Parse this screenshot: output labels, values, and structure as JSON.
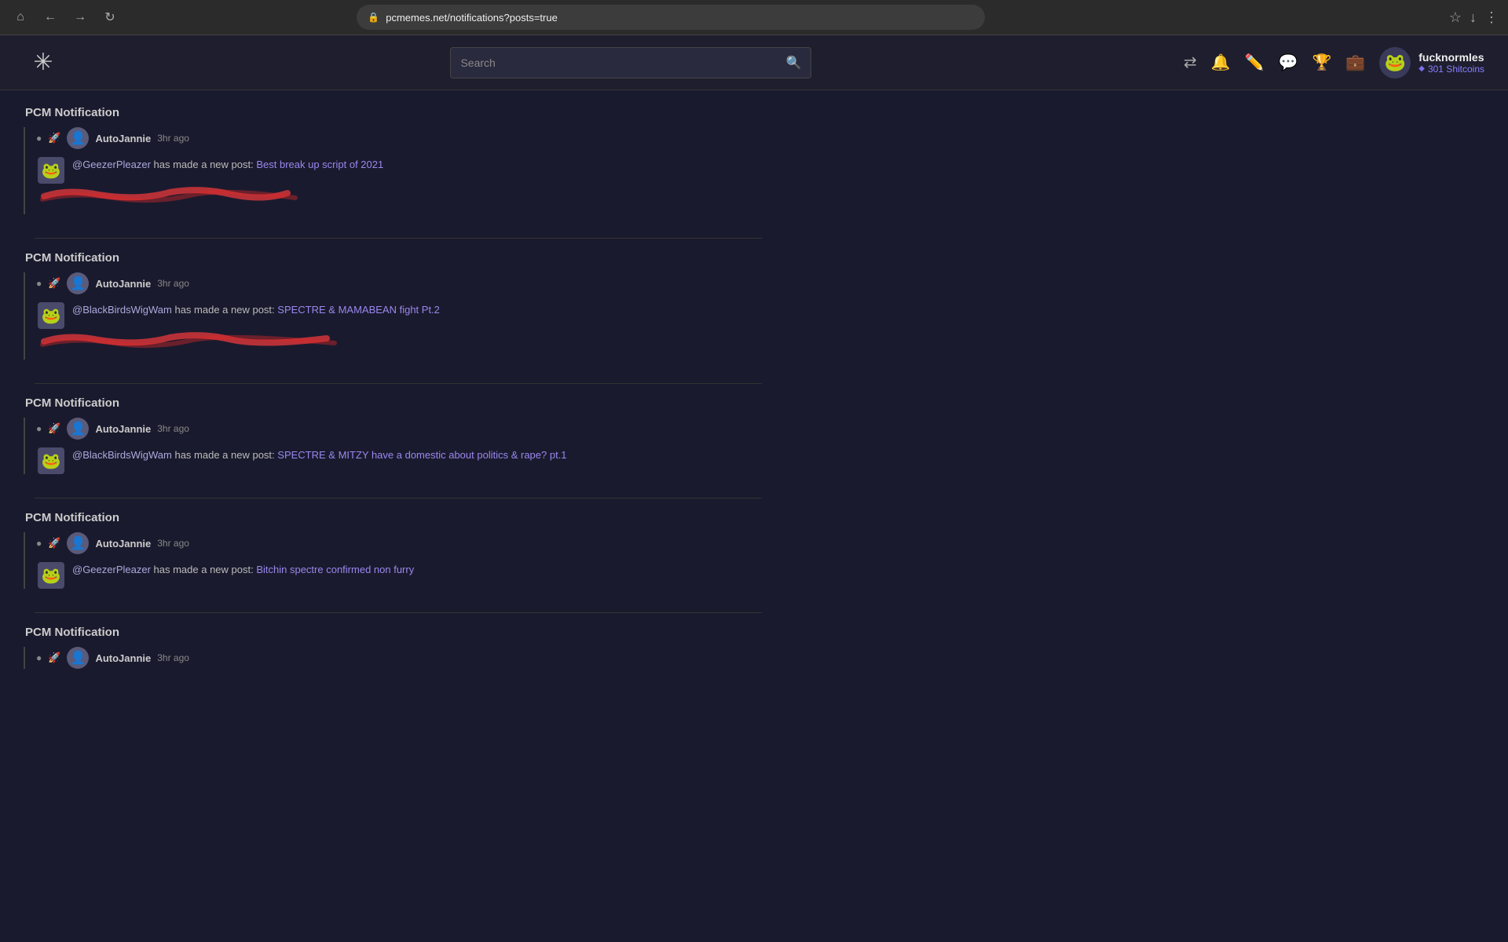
{
  "browser": {
    "url": "pcmemes.net/notifications?posts=true",
    "back_label": "←",
    "forward_label": "→",
    "refresh_label": "↻",
    "home_label": "⌂",
    "bookmark_label": "☆",
    "download_label": "↓",
    "menu_label": "⋮"
  },
  "header": {
    "logo": "✳",
    "search_placeholder": "Search",
    "icons": {
      "shuffle": "⇄",
      "bell": "🔔",
      "feather": "✏",
      "chat": "💬",
      "trophy": "🏆",
      "wallet": "💼"
    },
    "user": {
      "name": "fucknormles",
      "coins": "301 Shitcoins",
      "avatar": "🐸"
    }
  },
  "notifications": [
    {
      "id": "notif-1",
      "header": "PCM Notification",
      "meta": {
        "icon": "●",
        "rocket": "🚀",
        "username": "AutoJannie",
        "time": "3hr ago"
      },
      "poster": "🐸",
      "mention": "@GeezerPleazer",
      "action": "has made a new post:",
      "post_title": "Best break up script of 2021",
      "has_scribble": true,
      "scribble_width": 340,
      "scribble_height": 35
    },
    {
      "id": "notif-2",
      "header": "PCM Notification",
      "meta": {
        "icon": "●",
        "rocket": "🚀",
        "username": "AutoJannie",
        "time": "3hr ago"
      },
      "poster": "🐸",
      "mention": "@BlackBirdsWigWam",
      "action": "has made a new post:",
      "post_title": "SPECTRE & MAMABEAN fight Pt.2",
      "has_scribble": true,
      "scribble_width": 390,
      "scribble_height": 35
    },
    {
      "id": "notif-3",
      "header": "PCM Notification",
      "meta": {
        "icon": "●",
        "rocket": "🚀",
        "username": "AutoJannie",
        "time": "3hr ago"
      },
      "poster": "🐸",
      "mention": "@BlackBirdsWigWam",
      "action": "has made a new post:",
      "post_title": "SPECTRE & MITZY have a domestic about politics & rape? pt.1",
      "has_scribble": false
    },
    {
      "id": "notif-4",
      "header": "PCM Notification",
      "meta": {
        "icon": "●",
        "rocket": "🚀",
        "username": "AutoJannie",
        "time": "3hr ago"
      },
      "poster": "🐸",
      "mention": "@GeezerPleazer",
      "action": "has made a new post:",
      "post_title": "Bitchin spectre confirmed non furry",
      "has_scribble": false
    },
    {
      "id": "notif-5",
      "header": "PCM Notification",
      "meta": {
        "icon": "●",
        "rocket": "🚀",
        "username": "AutoJannie",
        "time": "3hr ago"
      },
      "poster": "🐸",
      "mention": "",
      "action": "",
      "post_title": "",
      "has_scribble": false
    }
  ]
}
